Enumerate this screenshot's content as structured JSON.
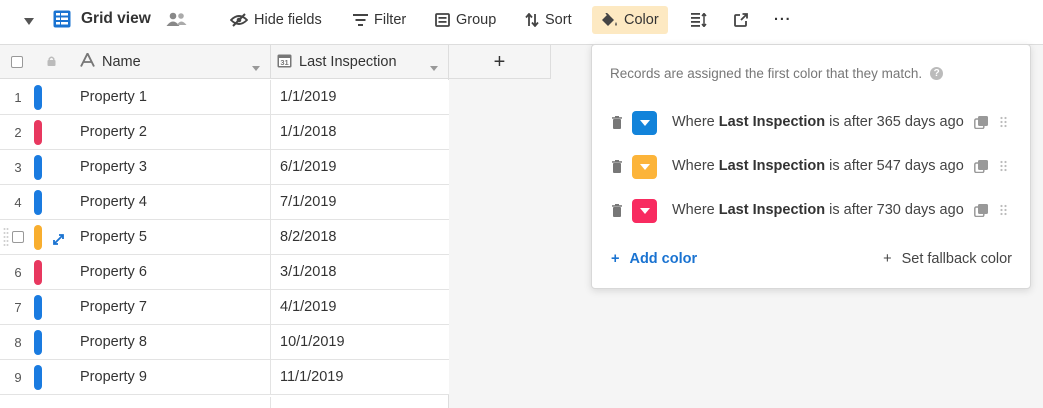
{
  "toolbar": {
    "view_name": "Grid view",
    "hide_fields": "Hide fields",
    "filter": "Filter",
    "group": "Group",
    "sort": "Sort",
    "color": "Color",
    "more": "···"
  },
  "grid": {
    "columns": [
      "Name",
      "Last Inspection"
    ],
    "add_column": "+",
    "rows": [
      {
        "num": "1",
        "name": "Property 1",
        "inspection": "1/1/2019",
        "color": "#1a7be0"
      },
      {
        "num": "2",
        "name": "Property 2",
        "inspection": "1/1/2018",
        "color": "#e8385f"
      },
      {
        "num": "3",
        "name": "Property 3",
        "inspection": "6/1/2019",
        "color": "#1a7be0"
      },
      {
        "num": "4",
        "name": "Property 4",
        "inspection": "7/1/2019",
        "color": "#1a7be0"
      },
      {
        "num": "",
        "name": "Property 5",
        "inspection": "8/2/2018",
        "color": "#f8ae2f",
        "hovered": true
      },
      {
        "num": "6",
        "name": "Property 6",
        "inspection": "3/1/2018",
        "color": "#e8385f"
      },
      {
        "num": "7",
        "name": "Property 7",
        "inspection": "4/1/2019",
        "color": "#1a7be0"
      },
      {
        "num": "8",
        "name": "Property 8",
        "inspection": "10/1/2019",
        "color": "#1a7be0"
      },
      {
        "num": "9",
        "name": "Property 9",
        "inspection": "11/1/2019",
        "color": "#1a7be0"
      }
    ]
  },
  "color_popover": {
    "help_text": "Records are assigned the first color that they match.",
    "help_icon": "?",
    "rules": [
      {
        "prefix": "Where",
        "field": "Last Inspection",
        "condition": "is after 365 days ago",
        "color": "#1283da"
      },
      {
        "prefix": "Where",
        "field": "Last Inspection",
        "condition": "is after 547 days ago",
        "color": "#fcb43a"
      },
      {
        "prefix": "Where",
        "field": "Last Inspection",
        "condition": "is after 730 days ago",
        "color": "#f82b60"
      }
    ],
    "add_color": "Add color",
    "add_icon": "+",
    "fallback": "Set fallback color",
    "fallback_icon": "+"
  },
  "colors": {
    "accent": "#1a73d1",
    "color_button_bg": "#fde9c2",
    "header_bg": "#f5f5f5",
    "border": "#dddddd"
  },
  "icons": {
    "view": "grid-view-icon",
    "collaborators": "people-icon",
    "hide_fields": "eye-slash-icon",
    "filter": "filter-icon",
    "group": "group-icon",
    "sort": "sort-icon",
    "color": "paint-bucket-icon",
    "row_height": "row-height-icon",
    "share": "share-icon",
    "name_field": "text-field-icon",
    "date_field": "calendar-icon",
    "expand": "expand-record-icon",
    "delete": "trash-icon",
    "duplicate": "duplicate-icon",
    "drag": "drag-handle-icon"
  }
}
